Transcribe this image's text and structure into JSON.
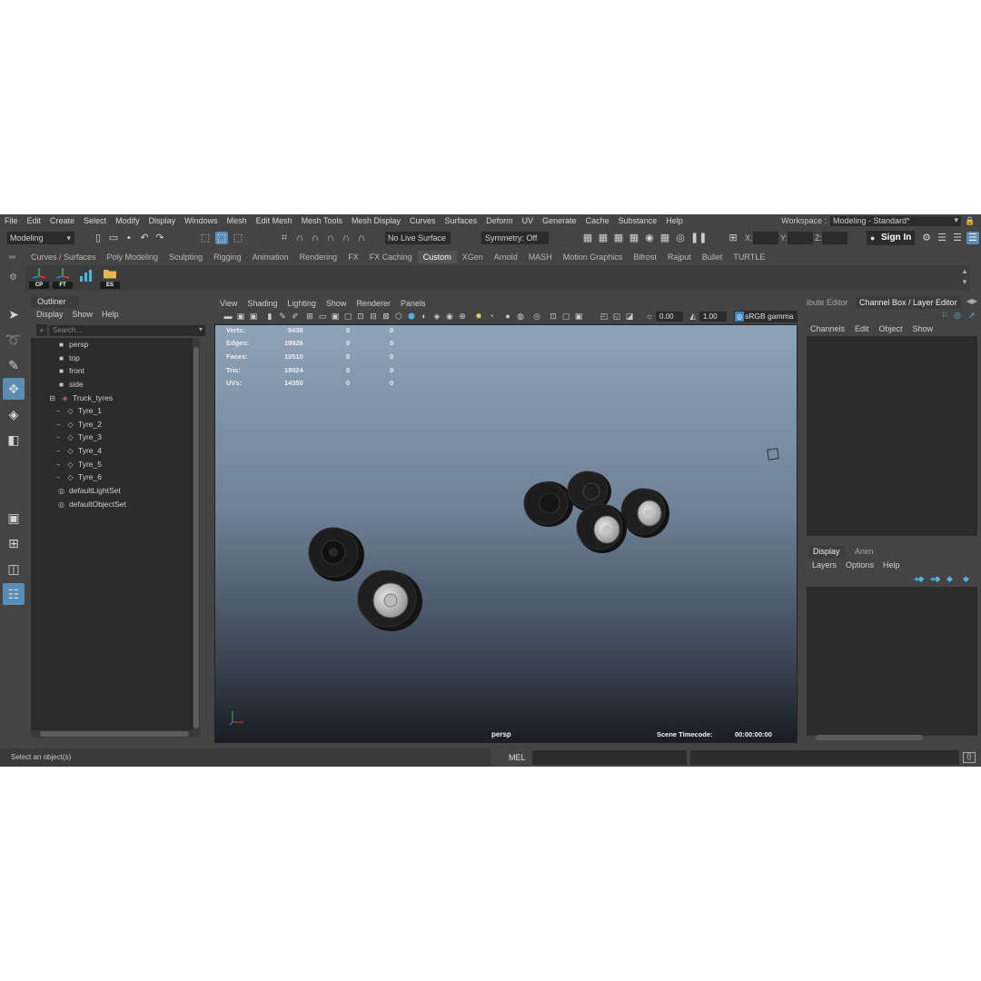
{
  "menubar": {
    "items": [
      "File",
      "Edit",
      "Create",
      "Select",
      "Modify",
      "Display",
      "Windows",
      "Mesh",
      "Edit Mesh",
      "Mesh Tools",
      "Mesh Display",
      "Curves",
      "Surfaces",
      "Deform",
      "UV",
      "Generate",
      "Cache",
      "Substance",
      "Help"
    ],
    "workspace_label": "Workspace :",
    "workspace_value": "Modeling - Standard*"
  },
  "statusline": {
    "mode": "Modeling",
    "live_surface": "No Live Surface",
    "symmetry": "Symmetry: Off",
    "x_label": "X:",
    "y_label": "Y:",
    "z_label": "Z:",
    "sign_in": "Sign In"
  },
  "shelf": {
    "tabs": [
      "Curves / Surfaces",
      "Poly Modeling",
      "Sculpting",
      "Rigging",
      "Animation",
      "Rendering",
      "FX",
      "FX Caching",
      "Custom",
      "XGen",
      "Arnold",
      "MASH",
      "Motion Graphics",
      "Bifrost",
      "Rajput",
      "Bullet",
      "TURTLE"
    ],
    "active_tab": "Custom",
    "buttons": [
      {
        "label": "CP",
        "icon": "axis-icon"
      },
      {
        "label": "FT",
        "icon": "axis-icon"
      },
      {
        "label": "",
        "icon": "bar-graph-icon"
      },
      {
        "label": "ES",
        "icon": "folder-icon"
      }
    ]
  },
  "outliner": {
    "title": "Outliner",
    "menu": [
      "Display",
      "Show",
      "Help"
    ],
    "search_placeholder": "Search...",
    "items": [
      {
        "label": "persp",
        "icon": "camera-icon",
        "indent": 1
      },
      {
        "label": "top",
        "icon": "camera-icon",
        "indent": 1
      },
      {
        "label": "front",
        "icon": "camera-icon",
        "indent": 1
      },
      {
        "label": "side",
        "icon": "camera-icon",
        "indent": 1
      },
      {
        "label": "Truck_tyres",
        "icon": "group-icon",
        "indent": 1,
        "expanded": true
      },
      {
        "label": "Tyre_1",
        "icon": "mesh-icon",
        "indent": 2
      },
      {
        "label": "Tyre_2",
        "icon": "mesh-icon",
        "indent": 2
      },
      {
        "label": "Tyre_3",
        "icon": "mesh-icon",
        "indent": 2
      },
      {
        "label": "Tyre_4",
        "icon": "mesh-icon",
        "indent": 2
      },
      {
        "label": "Tyre_5",
        "icon": "mesh-icon",
        "indent": 2
      },
      {
        "label": "Tyre_6",
        "icon": "mesh-icon",
        "indent": 2
      },
      {
        "label": "defaultLightSet",
        "icon": "set-icon",
        "indent": 1
      },
      {
        "label": "defaultObjectSet",
        "icon": "set-icon",
        "indent": 1
      }
    ]
  },
  "viewport": {
    "menu": [
      "View",
      "Shading",
      "Lighting",
      "Show",
      "Renderer",
      "Panels"
    ],
    "near_value": "0.00",
    "far_value": "1.00",
    "color_space": "sRGB gamma",
    "hud": [
      {
        "label": "Verts:",
        "v1": "9438",
        "v2": "0",
        "v3": "0"
      },
      {
        "label": "Edges:",
        "v1": "19926",
        "v2": "0",
        "v3": "0"
      },
      {
        "label": "Faces:",
        "v1": "10510",
        "v2": "0",
        "v3": "0"
      },
      {
        "label": "Tris:",
        "v1": "18024",
        "v2": "0",
        "v3": "0"
      },
      {
        "label": "UVs:",
        "v1": "14350",
        "v2": "0",
        "v3": "0"
      }
    ],
    "camera_label": "persp",
    "timecode_label": "Scene Timecode:",
    "timecode_value": "00:00:00:00",
    "gradient_top": "#8ea2b8",
    "gradient_bottom": "#1a1d22"
  },
  "right_panel": {
    "tab_attribute": "ibute Editor",
    "tab_channel": "Channel Box / Layer Editor",
    "channel_menu": [
      "Channels",
      "Edit",
      "Object",
      "Show"
    ],
    "layer_tabs": [
      "Display",
      "Anim"
    ],
    "layer_menu": [
      "Layers",
      "Options",
      "Help"
    ]
  },
  "bottom": {
    "help_text": "Select an object(s)",
    "mel_label": "MEL"
  },
  "colors": {
    "ui_bg": "#444444",
    "field_bg": "#2b2b2b",
    "accent": "#5a8cb4",
    "maya_logo": "#2fb7d4"
  }
}
